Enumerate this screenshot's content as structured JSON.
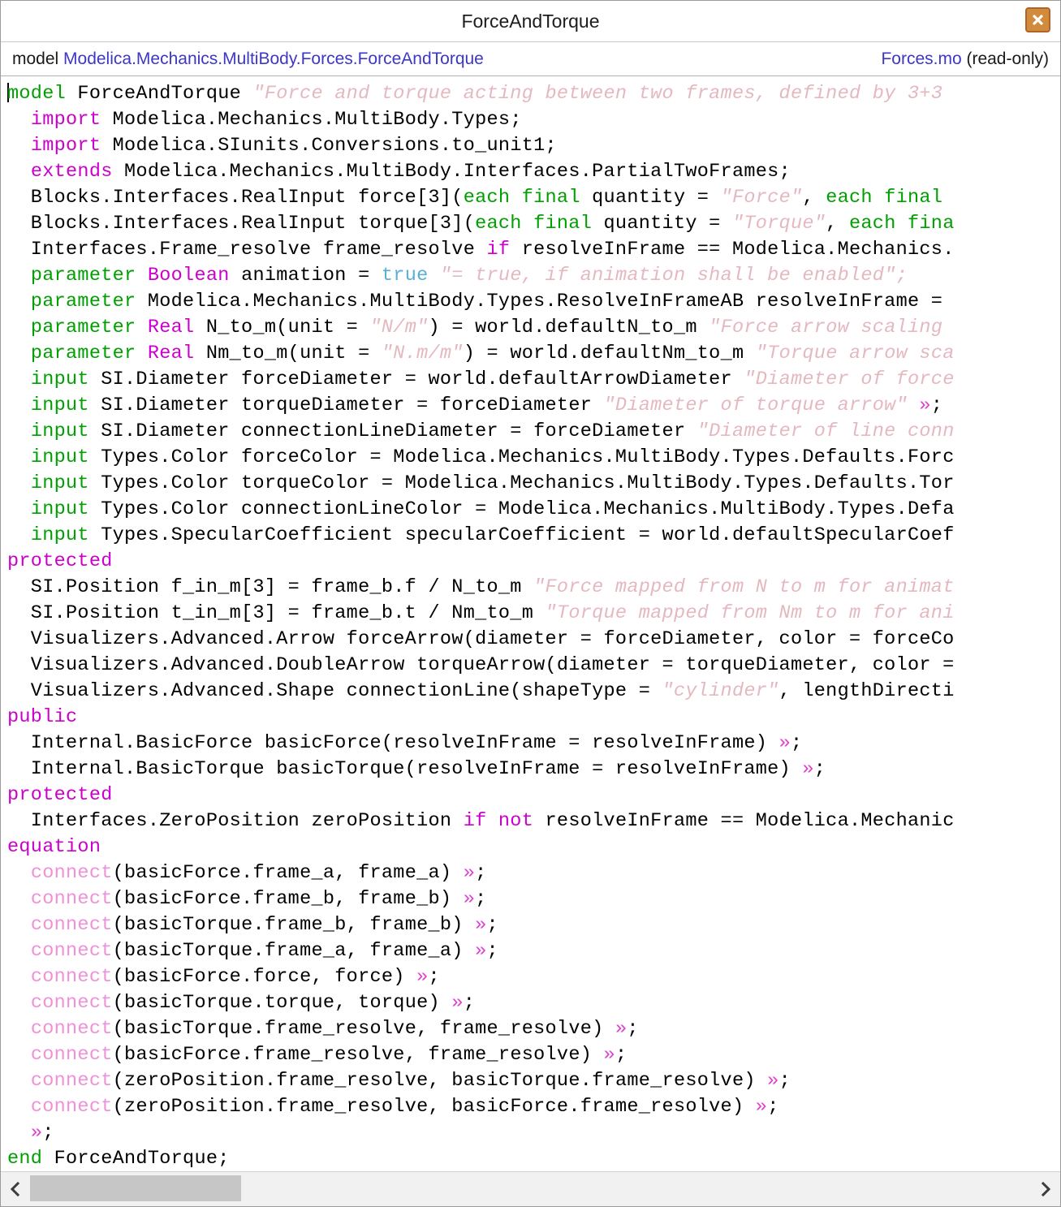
{
  "window": {
    "title": "ForceAndTorque",
    "close_icon": "close-icon"
  },
  "pathbar": {
    "prefix": "model ",
    "path": "Modelica.Mechanics.MultiBody.Forces.ForceAndTorque",
    "file": "Forces.mo",
    "readonly": " (read-only)"
  },
  "code": {
    "lines": [
      [
        [
          "kw",
          "model"
        ],
        [
          "plain",
          " ForceAndTorque "
        ],
        [
          "str",
          "\"Force and torque acting between two frames, defined by 3+3"
        ]
      ],
      [
        [
          "plain",
          "  "
        ],
        [
          "kw2",
          "import"
        ],
        [
          "plain",
          " Modelica.Mechanics.MultiBody.Types;"
        ]
      ],
      [
        [
          "plain",
          "  "
        ],
        [
          "kw2",
          "import"
        ],
        [
          "plain",
          " Modelica.SIunits.Conversions.to_unit1;"
        ]
      ],
      [
        [
          "plain",
          "  "
        ],
        [
          "kw2",
          "extends"
        ],
        [
          "plain",
          " Modelica.Mechanics.MultiBody.Interfaces.PartialTwoFrames;"
        ]
      ],
      [
        [
          "plain",
          "  Blocks.Interfaces.RealInput force[3]("
        ],
        [
          "kw",
          "each final"
        ],
        [
          "plain",
          " quantity = "
        ],
        [
          "str",
          "\"Force\""
        ],
        [
          "plain",
          ", "
        ],
        [
          "kw",
          "each final"
        ]
      ],
      [
        [
          "plain",
          "  Blocks.Interfaces.RealInput torque[3]("
        ],
        [
          "kw",
          "each final"
        ],
        [
          "plain",
          " quantity = "
        ],
        [
          "str",
          "\"Torque\""
        ],
        [
          "plain",
          ", "
        ],
        [
          "kw",
          "each fina"
        ]
      ],
      [
        [
          "plain",
          "  Interfaces.Frame_resolve frame_resolve "
        ],
        [
          "kw2",
          "if"
        ],
        [
          "plain",
          " resolveInFrame == Modelica.Mechanics."
        ]
      ],
      [
        [
          "plain",
          "  "
        ],
        [
          "kw",
          "parameter"
        ],
        [
          "plain",
          " "
        ],
        [
          "type",
          "Boolean"
        ],
        [
          "plain",
          " animation = "
        ],
        [
          "num",
          "true"
        ],
        [
          "plain",
          " "
        ],
        [
          "str",
          "\"= true, if animation shall be enabled\";"
        ]
      ],
      [
        [
          "plain",
          "  "
        ],
        [
          "kw",
          "parameter"
        ],
        [
          "plain",
          " Modelica.Mechanics.MultiBody.Types.ResolveInFrameAB resolveInFrame = "
        ]
      ],
      [
        [
          "plain",
          "  "
        ],
        [
          "kw",
          "parameter"
        ],
        [
          "plain",
          " "
        ],
        [
          "type",
          "Real"
        ],
        [
          "plain",
          " N_to_m(unit = "
        ],
        [
          "str",
          "\"N/m\""
        ],
        [
          "plain",
          ") = world.defaultN_to_m "
        ],
        [
          "str",
          "\"Force arrow scaling"
        ]
      ],
      [
        [
          "plain",
          "  "
        ],
        [
          "kw",
          "parameter"
        ],
        [
          "plain",
          " "
        ],
        [
          "type",
          "Real"
        ],
        [
          "plain",
          " Nm_to_m(unit = "
        ],
        [
          "str",
          "\"N.m/m\""
        ],
        [
          "plain",
          ") = world.defaultNm_to_m "
        ],
        [
          "str",
          "\"Torque arrow sca"
        ]
      ],
      [
        [
          "plain",
          "  "
        ],
        [
          "kw",
          "input"
        ],
        [
          "plain",
          " SI.Diameter forceDiameter = world.defaultArrowDiameter "
        ],
        [
          "str",
          "\"Diameter of force"
        ]
      ],
      [
        [
          "plain",
          "  "
        ],
        [
          "kw",
          "input"
        ],
        [
          "plain",
          " SI.Diameter torqueDiameter = forceDiameter "
        ],
        [
          "str",
          "\"Diameter of torque arrow\""
        ],
        [
          "plain",
          " "
        ],
        [
          "guil",
          "»"
        ],
        [
          "plain",
          ";"
        ]
      ],
      [
        [
          "plain",
          "  "
        ],
        [
          "kw",
          "input"
        ],
        [
          "plain",
          " SI.Diameter connectionLineDiameter = forceDiameter "
        ],
        [
          "str",
          "\"Diameter of line conn"
        ]
      ],
      [
        [
          "plain",
          "  "
        ],
        [
          "kw",
          "input"
        ],
        [
          "plain",
          " Types.Color forceColor = Modelica.Mechanics.MultiBody.Types.Defaults.Forc"
        ]
      ],
      [
        [
          "plain",
          "  "
        ],
        [
          "kw",
          "input"
        ],
        [
          "plain",
          " Types.Color torqueColor = Modelica.Mechanics.MultiBody.Types.Defaults.Tor"
        ]
      ],
      [
        [
          "plain",
          "  "
        ],
        [
          "kw",
          "input"
        ],
        [
          "plain",
          " Types.Color connectionLineColor = Modelica.Mechanics.MultiBody.Types.Defa"
        ]
      ],
      [
        [
          "plain",
          "  "
        ],
        [
          "kw",
          "input"
        ],
        [
          "plain",
          " Types.SpecularCoefficient specularCoefficient = world.defaultSpecularCoef"
        ]
      ],
      [
        [
          "kw2",
          "protected"
        ]
      ],
      [
        [
          "plain",
          "  SI.Position f_in_m[3] = frame_b.f / N_to_m "
        ],
        [
          "str",
          "\"Force mapped from N to m for animat"
        ]
      ],
      [
        [
          "plain",
          "  SI.Position t_in_m[3] = frame_b.t / Nm_to_m "
        ],
        [
          "str",
          "\"Torque mapped from Nm to m for ani"
        ]
      ],
      [
        [
          "plain",
          "  Visualizers.Advanced.Arrow forceArrow(diameter = forceDiameter, color = forceCo"
        ]
      ],
      [
        [
          "plain",
          "  Visualizers.Advanced.DoubleArrow torqueArrow(diameter = torqueDiameter, color = "
        ]
      ],
      [
        [
          "plain",
          "  Visualizers.Advanced.Shape connectionLine(shapeType = "
        ],
        [
          "str",
          "\"cylinder\""
        ],
        [
          "plain",
          ", lengthDirecti"
        ]
      ],
      [
        [
          "kw2",
          "public"
        ]
      ],
      [
        [
          "plain",
          "  Internal.BasicForce basicForce(resolveInFrame = resolveInFrame) "
        ],
        [
          "guil",
          "»"
        ],
        [
          "plain",
          ";"
        ]
      ],
      [
        [
          "plain",
          "  Internal.BasicTorque basicTorque(resolveInFrame = resolveInFrame) "
        ],
        [
          "guil",
          "»"
        ],
        [
          "plain",
          ";"
        ]
      ],
      [
        [
          "kw2",
          "protected"
        ]
      ],
      [
        [
          "plain",
          "  Interfaces.ZeroPosition zeroPosition "
        ],
        [
          "kw2",
          "if not"
        ],
        [
          "plain",
          " resolveInFrame == Modelica.Mechanic"
        ]
      ],
      [
        [
          "kw2",
          "equation"
        ]
      ],
      [
        [
          "plain",
          "  "
        ],
        [
          "connect",
          "connect"
        ],
        [
          "plain",
          "(basicForce.frame_a, frame_a) "
        ],
        [
          "guil",
          "»"
        ],
        [
          "plain",
          ";"
        ]
      ],
      [
        [
          "plain",
          "  "
        ],
        [
          "connect",
          "connect"
        ],
        [
          "plain",
          "(basicForce.frame_b, frame_b) "
        ],
        [
          "guil",
          "»"
        ],
        [
          "plain",
          ";"
        ]
      ],
      [
        [
          "plain",
          "  "
        ],
        [
          "connect",
          "connect"
        ],
        [
          "plain",
          "(basicTorque.frame_b, frame_b) "
        ],
        [
          "guil",
          "»"
        ],
        [
          "plain",
          ";"
        ]
      ],
      [
        [
          "plain",
          "  "
        ],
        [
          "connect",
          "connect"
        ],
        [
          "plain",
          "(basicTorque.frame_a, frame_a) "
        ],
        [
          "guil",
          "»"
        ],
        [
          "plain",
          ";"
        ]
      ],
      [
        [
          "plain",
          "  "
        ],
        [
          "connect",
          "connect"
        ],
        [
          "plain",
          "(basicForce.force, force) "
        ],
        [
          "guil",
          "»"
        ],
        [
          "plain",
          ";"
        ]
      ],
      [
        [
          "plain",
          "  "
        ],
        [
          "connect",
          "connect"
        ],
        [
          "plain",
          "(basicTorque.torque, torque) "
        ],
        [
          "guil",
          "»"
        ],
        [
          "plain",
          ";"
        ]
      ],
      [
        [
          "plain",
          "  "
        ],
        [
          "connect",
          "connect"
        ],
        [
          "plain",
          "(basicTorque.frame_resolve, frame_resolve) "
        ],
        [
          "guil",
          "»"
        ],
        [
          "plain",
          ";"
        ]
      ],
      [
        [
          "plain",
          "  "
        ],
        [
          "connect",
          "connect"
        ],
        [
          "plain",
          "(basicForce.frame_resolve, frame_resolve) "
        ],
        [
          "guil",
          "»"
        ],
        [
          "plain",
          ";"
        ]
      ],
      [
        [
          "plain",
          "  "
        ],
        [
          "connect",
          "connect"
        ],
        [
          "plain",
          "(zeroPosition.frame_resolve, basicTorque.frame_resolve) "
        ],
        [
          "guil",
          "»"
        ],
        [
          "plain",
          ";"
        ]
      ],
      [
        [
          "plain",
          "  "
        ],
        [
          "connect",
          "connect"
        ],
        [
          "plain",
          "(zeroPosition.frame_resolve, basicForce.frame_resolve) "
        ],
        [
          "guil",
          "»"
        ],
        [
          "plain",
          ";"
        ]
      ],
      [
        [
          "plain",
          "  "
        ],
        [
          "guil",
          "»"
        ],
        [
          "plain",
          ";"
        ]
      ],
      [
        [
          "kw",
          "end"
        ],
        [
          "plain",
          " ForceAndTorque;"
        ]
      ]
    ]
  },
  "scrollbar": {
    "left_arrow_icon": "chevron-left-icon",
    "right_arrow_icon": "chevron-right-icon"
  },
  "colors": {
    "keyword_green": "#00a000",
    "keyword_magenta": "#cc00cc",
    "string_pink": "#e5b8c0",
    "connect_pink": "#f090d8",
    "link_blue": "#3d37c4",
    "close_orange": "#d08c3c"
  }
}
